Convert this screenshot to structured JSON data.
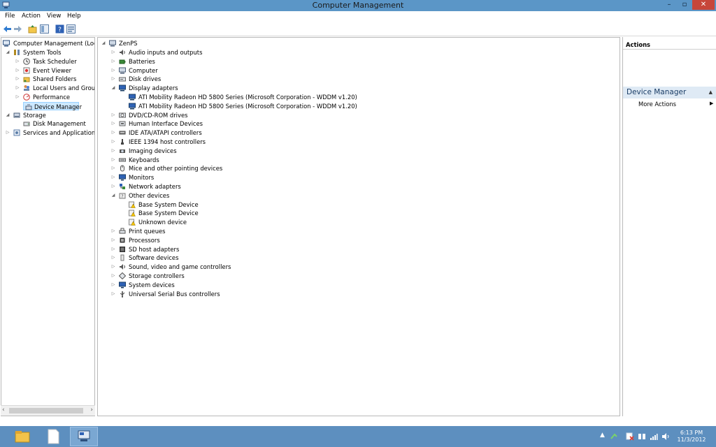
{
  "window": {
    "title": "Computer Management",
    "controls": {
      "minimize": "–",
      "maximize": "▫",
      "close": "✕"
    }
  },
  "menu": [
    "File",
    "Action",
    "View",
    "Help"
  ],
  "toolbar": [
    "back-icon",
    "forward-icon",
    "up-icon",
    "show-hide-tree-icon",
    "help-icon",
    "properties-icon"
  ],
  "left_tree": {
    "root": "Computer Management (Local",
    "items": [
      {
        "label": "System Tools",
        "level": 1,
        "arrow": "◢",
        "icon": "tools-icon"
      },
      {
        "label": "Task Scheduler",
        "level": 2,
        "arrow": "▷",
        "icon": "clock-icon"
      },
      {
        "label": "Event Viewer",
        "level": 2,
        "arrow": "▷",
        "icon": "event-viewer-icon"
      },
      {
        "label": "Shared Folders",
        "level": 2,
        "arrow": "▷",
        "icon": "shared-folder-icon"
      },
      {
        "label": "Local Users and Groups",
        "level": 2,
        "arrow": "▷",
        "icon": "users-icon"
      },
      {
        "label": "Performance",
        "level": 2,
        "arrow": "▷",
        "icon": "performance-icon"
      },
      {
        "label": "Device Manager",
        "level": 2,
        "arrow": "",
        "icon": "device-manager-icon",
        "selected": true
      },
      {
        "label": "Storage",
        "level": 1,
        "arrow": "◢",
        "icon": "storage-icon"
      },
      {
        "label": "Disk Management",
        "level": 2,
        "arrow": "",
        "icon": "disk-icon"
      },
      {
        "label": "Services and Applications",
        "level": 1,
        "arrow": "▷",
        "icon": "services-icon"
      }
    ]
  },
  "device_tree": {
    "root": "ZenPS",
    "items": [
      {
        "label": "Audio inputs and outputs",
        "level": 1,
        "arrow": "▷",
        "icon": "audio-icon"
      },
      {
        "label": "Batteries",
        "level": 1,
        "arrow": "▷",
        "icon": "battery-icon"
      },
      {
        "label": "Computer",
        "level": 1,
        "arrow": "▷",
        "icon": "computer-icon"
      },
      {
        "label": "Disk drives",
        "level": 1,
        "arrow": "▷",
        "icon": "disk-drive-icon"
      },
      {
        "label": "Display adapters",
        "level": 1,
        "arrow": "◢",
        "icon": "display-adapter-icon"
      },
      {
        "label": "ATI Mobility Radeon HD 5800 Series (Microsoft Corporation - WDDM v1.20)",
        "level": 2,
        "arrow": "",
        "icon": "display-adapter-icon"
      },
      {
        "label": "ATI Mobility Radeon HD 5800 Series (Microsoft Corporation - WDDM v1.20)",
        "level": 2,
        "arrow": "",
        "icon": "display-adapter-icon"
      },
      {
        "label": "DVD/CD-ROM drives",
        "level": 1,
        "arrow": "▷",
        "icon": "dvd-icon"
      },
      {
        "label": "Human Interface Devices",
        "level": 1,
        "arrow": "▷",
        "icon": "hid-icon"
      },
      {
        "label": "IDE ATA/ATAPI controllers",
        "level": 1,
        "arrow": "▷",
        "icon": "ide-icon"
      },
      {
        "label": "IEEE 1394 host controllers",
        "level": 1,
        "arrow": "▷",
        "icon": "ieee1394-icon"
      },
      {
        "label": "Imaging devices",
        "level": 1,
        "arrow": "▷",
        "icon": "camera-icon"
      },
      {
        "label": "Keyboards",
        "level": 1,
        "arrow": "▷",
        "icon": "keyboard-icon"
      },
      {
        "label": "Mice and other pointing devices",
        "level": 1,
        "arrow": "▷",
        "icon": "mouse-icon"
      },
      {
        "label": "Monitors",
        "level": 1,
        "arrow": "▷",
        "icon": "monitor-icon"
      },
      {
        "label": "Network adapters",
        "level": 1,
        "arrow": "▷",
        "icon": "network-icon"
      },
      {
        "label": "Other devices",
        "level": 1,
        "arrow": "◢",
        "icon": "other-devices-icon"
      },
      {
        "label": "Base System Device",
        "level": 2,
        "arrow": "",
        "icon": "warning-device-icon"
      },
      {
        "label": "Base System Device",
        "level": 2,
        "arrow": "",
        "icon": "warning-device-icon"
      },
      {
        "label": "Unknown device",
        "level": 2,
        "arrow": "",
        "icon": "warning-device-icon"
      },
      {
        "label": "Print queues",
        "level": 1,
        "arrow": "▷",
        "icon": "printer-icon"
      },
      {
        "label": "Processors",
        "level": 1,
        "arrow": "▷",
        "icon": "processor-icon"
      },
      {
        "label": "SD host adapters",
        "level": 1,
        "arrow": "▷",
        "icon": "sd-icon"
      },
      {
        "label": "Software devices",
        "level": 1,
        "arrow": "▷",
        "icon": "software-device-icon"
      },
      {
        "label": "Sound, video and game controllers",
        "level": 1,
        "arrow": "▷",
        "icon": "sound-icon"
      },
      {
        "label": "Storage controllers",
        "level": 1,
        "arrow": "▷",
        "icon": "storage-controller-icon"
      },
      {
        "label": "System devices",
        "level": 1,
        "arrow": "▷",
        "icon": "system-device-icon"
      },
      {
        "label": "Universal Serial Bus controllers",
        "level": 1,
        "arrow": "▷",
        "icon": "usb-icon"
      }
    ]
  },
  "actions": {
    "header": "Actions",
    "section": "Device Manager",
    "more": "More Actions"
  },
  "taskbar": {
    "apps": [
      "file-explorer-icon",
      "notepad-icon",
      "computer-management-icon"
    ],
    "time": "6:13 PM",
    "date": "11/3/2012"
  },
  "colors": {
    "titlebar": "#5b96c7",
    "taskbar": "#5d8fbf",
    "selection": "#cce8ff",
    "close": "#c7463a"
  }
}
